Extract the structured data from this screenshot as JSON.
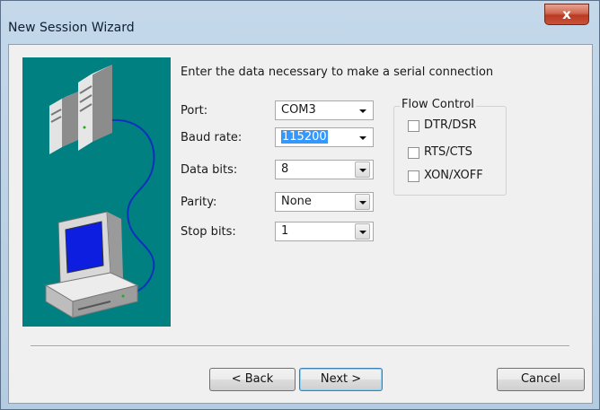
{
  "window": {
    "title": "New Session Wizard",
    "close_glyph": "x"
  },
  "heading": "Enter the data necessary to make a serial connection",
  "fields": {
    "port": {
      "label": "Port:",
      "value": "COM3"
    },
    "baud_rate": {
      "label": "Baud rate:",
      "value": "115200"
    },
    "data_bits": {
      "label": "Data bits:",
      "value": "8"
    },
    "parity": {
      "label": "Parity:",
      "value": "None"
    },
    "stop_bits": {
      "label": "Stop bits:",
      "value": "1"
    }
  },
  "flow_control": {
    "label": "Flow Control",
    "options": [
      {
        "label": "DTR/DSR",
        "checked": false
      },
      {
        "label": "RTS/CTS",
        "checked": false
      },
      {
        "label": "XON/XOFF",
        "checked": false
      }
    ]
  },
  "buttons": {
    "back": "< Back",
    "next": "Next >",
    "cancel": "Cancel"
  },
  "illustration": {
    "icons": [
      "server-icon",
      "computer-icon",
      "serial-cable-icon"
    ],
    "background": "#008080"
  },
  "colors": {
    "selection": "#3399ff",
    "close": "#c9523a"
  }
}
